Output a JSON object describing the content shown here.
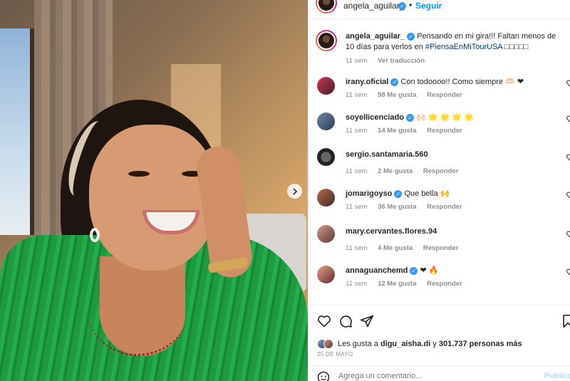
{
  "post": {
    "username": "angela_aguilar_",
    "follow_label": "Seguir",
    "separator": "•",
    "caption_text": "Pensando en mi gira!!! Faltan menos de 10 días para verlos en",
    "caption_hashtag": "#PiensaEnMiTourUSA",
    "caption_emojis": "□□□□□",
    "caption_time": "11 sem",
    "translate_label": "Ver traducción"
  },
  "comments": [
    {
      "user": "irany.oficial",
      "verified": true,
      "text": "Con todoooo!! Como siempre 🫶🏻 ❤",
      "time": "11 sem",
      "likes": "58 Me gusta",
      "reply": "Responder"
    },
    {
      "user": "soyellicenciado",
      "verified": true,
      "text": "🙌🏻 🌟 🌟 🌟 🌟",
      "time": "11 sem",
      "likes": "14 Me gusta",
      "reply": "Responder"
    },
    {
      "user": "sergio.santamaria.560",
      "verified": false,
      "text": "",
      "time": "11 sem",
      "likes": "2 Me gusta",
      "reply": "Responder"
    },
    {
      "user": "jomarigoyso",
      "verified": true,
      "text": "Que bella 🙌",
      "time": "11 sem",
      "likes": "36 Me gusta",
      "reply": "Responder"
    },
    {
      "user": "mary.cervantes.flores.94",
      "verified": false,
      "text": "",
      "time": "11 sem",
      "likes": "4 Me gusta",
      "reply": "Responder"
    },
    {
      "user": "annaguanchemd",
      "verified": true,
      "text": "❤ 🔥",
      "time": "11 sem",
      "likes": "12 Me gusta",
      "reply": "Responder"
    }
  ],
  "likes": {
    "prefix": "Les gusta a",
    "first_user": "digu_aisha.di",
    "connector": "y",
    "others": "301.737 personas más"
  },
  "date": "25 DE MAYO",
  "add_comment": {
    "placeholder": "Agrega un comentario...",
    "publish_label": "Publicar"
  },
  "icons": {
    "like": "heart-icon",
    "comment": "comment-icon",
    "share": "share-icon",
    "save": "bookmark-icon",
    "next": "chevron-right-icon",
    "emoji": "emoji-icon"
  },
  "colors": {
    "accent": "#0095f6",
    "verified": "#3897f0",
    "hashtag": "#00376b",
    "muted": "#8e8e8e"
  }
}
